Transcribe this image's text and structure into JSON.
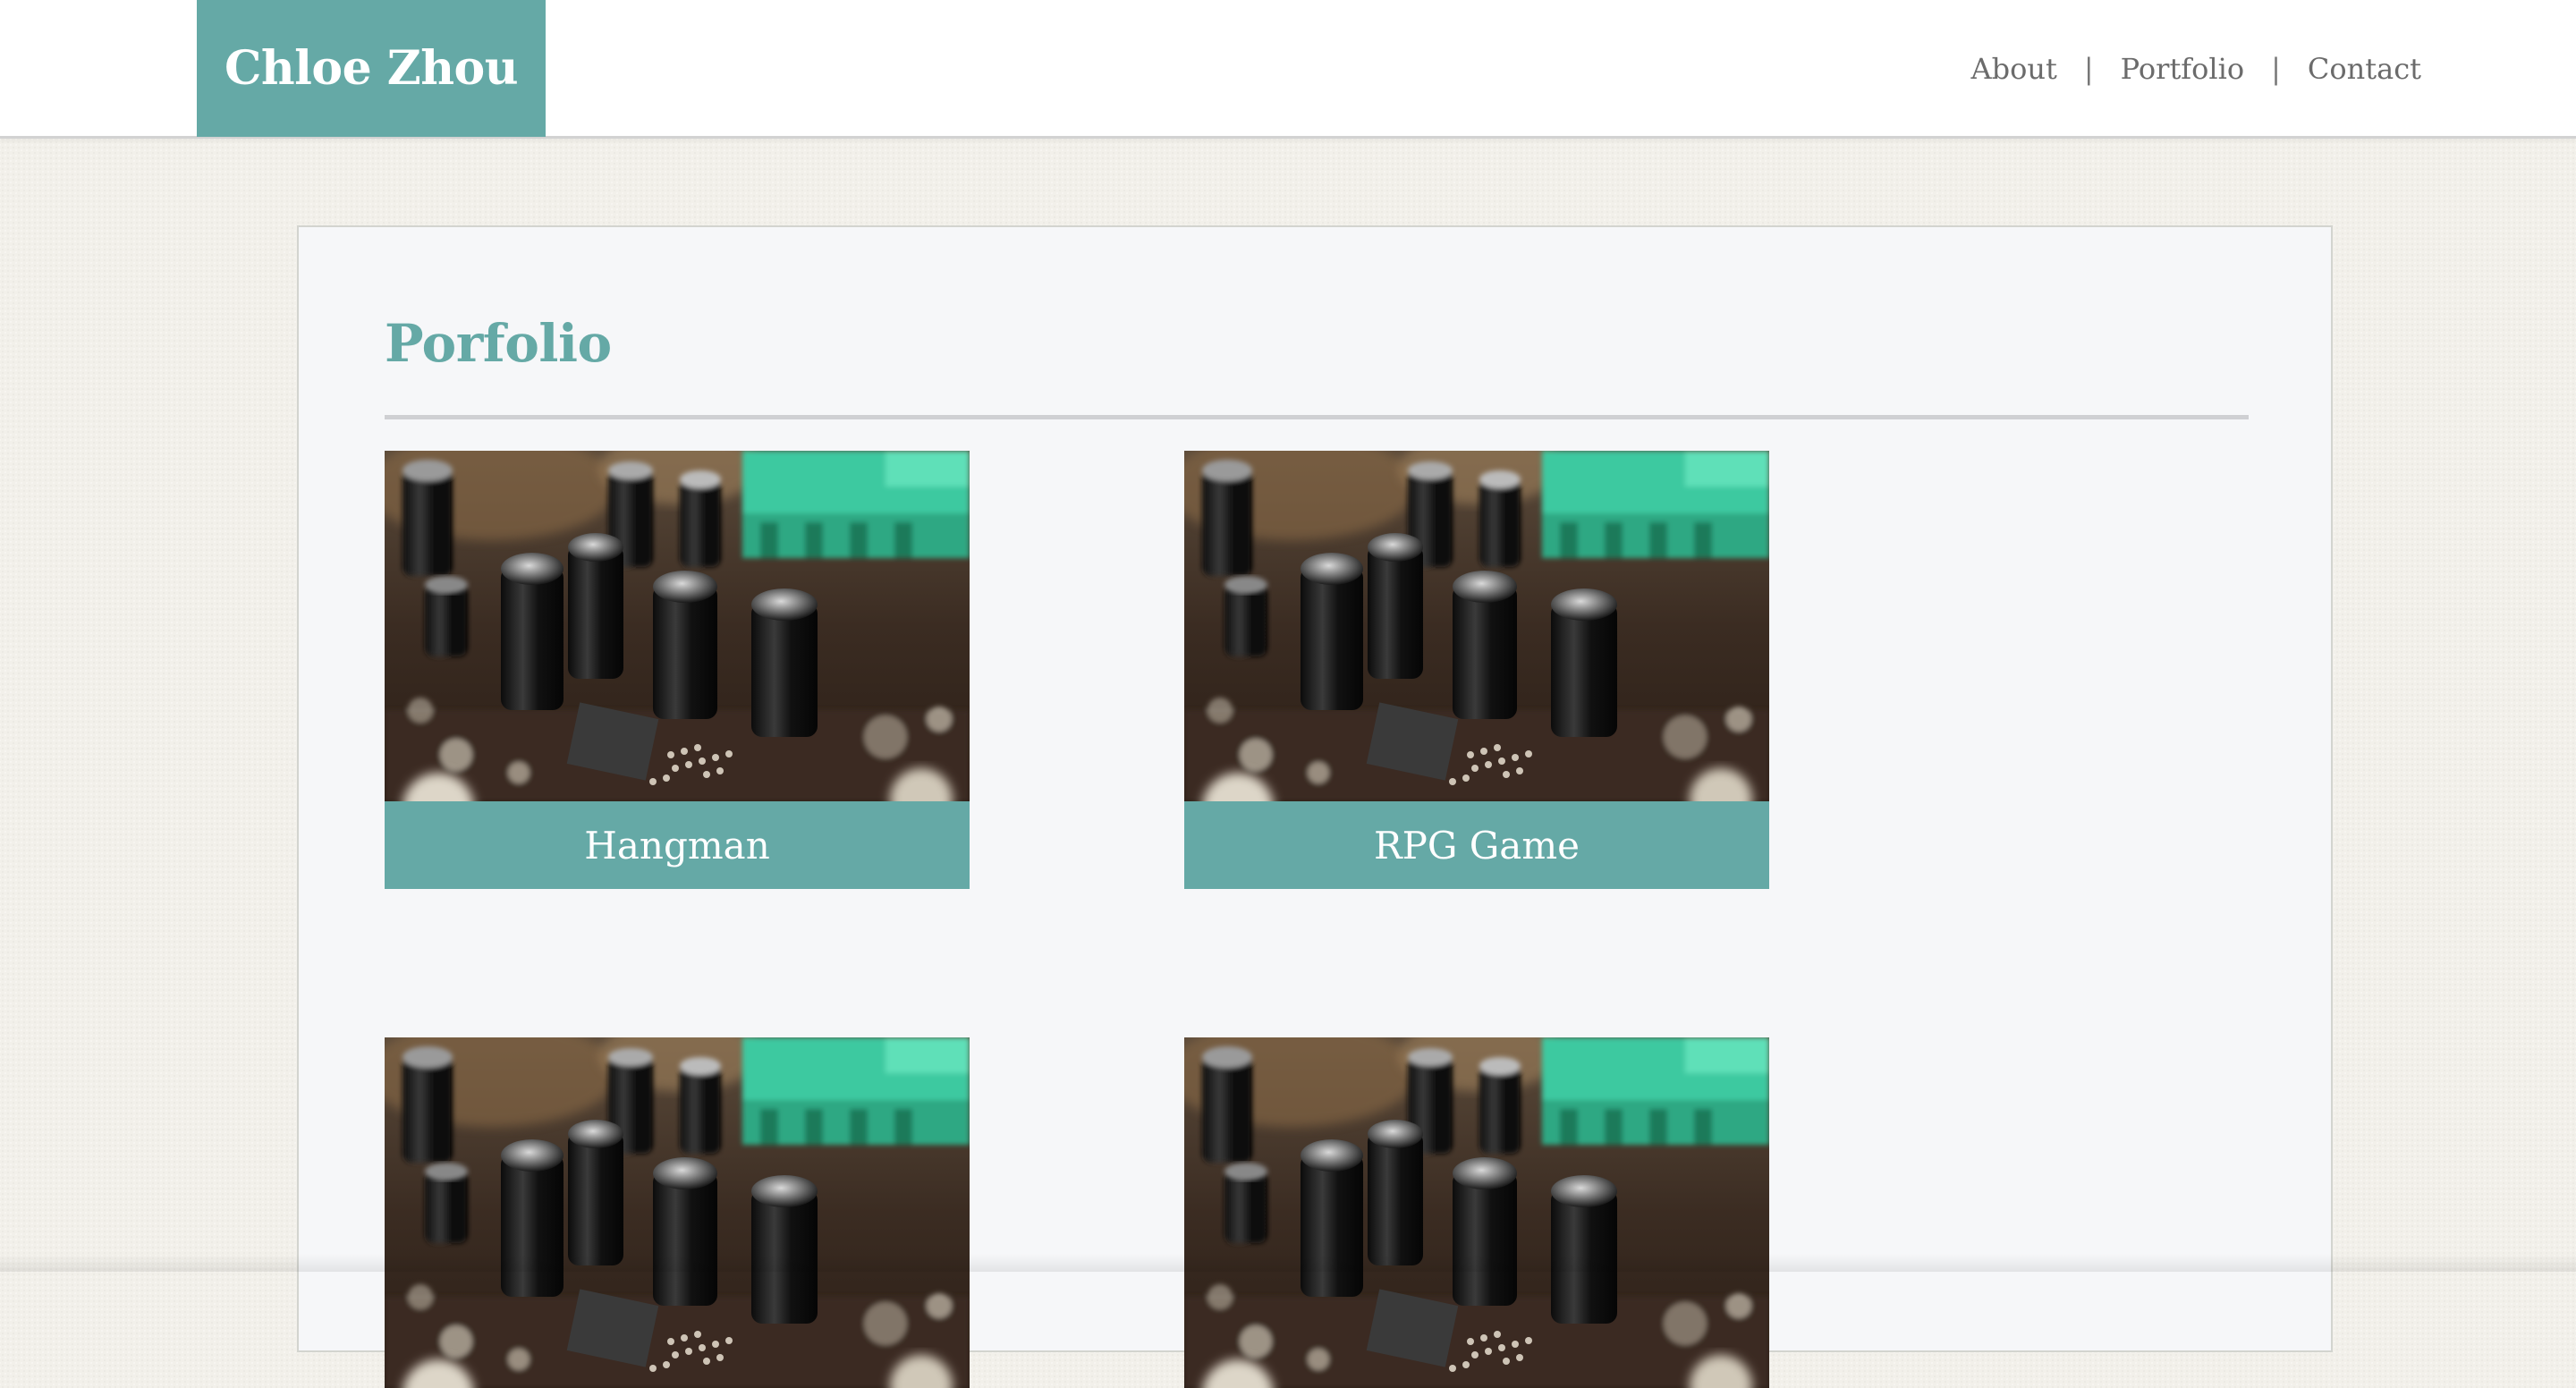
{
  "site": {
    "name": "Chloe Zhou"
  },
  "nav": {
    "items": [
      {
        "label": "About"
      },
      {
        "label": "Portfolio"
      },
      {
        "label": "Contact"
      }
    ],
    "separator": "|"
  },
  "main": {
    "title": "Porfolio",
    "projects": [
      {
        "title": "Hangman",
        "image": "circuit-board-thumbnail"
      },
      {
        "title": "RPG Game",
        "image": "circuit-board-thumbnail"
      },
      {
        "title": "",
        "image": "circuit-board-thumbnail"
      },
      {
        "title": "",
        "image": "circuit-board-thumbnail"
      }
    ]
  },
  "colors": {
    "accent": "#65a9a6",
    "page_background": "#f2f0ea",
    "panel_background": "#f6f7f9",
    "nav_text": "#6b6b6b"
  }
}
